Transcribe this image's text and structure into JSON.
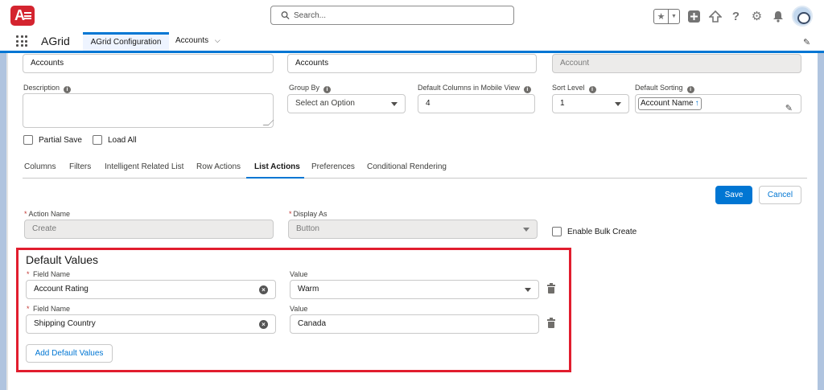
{
  "header": {
    "logo_text": "A",
    "search_placeholder": "Search..."
  },
  "nav": {
    "app_name": "AGrid",
    "tabs": [
      {
        "label": "AGrid Configuration"
      },
      {
        "label": "Accounts"
      }
    ]
  },
  "form": {
    "row1": [
      "Accounts",
      "Accounts",
      "Account"
    ],
    "description_label": "Description",
    "description_value": "",
    "group_by_label": "Group By",
    "group_by_value": "Select an Option",
    "mobile_cols_label": "Default Columns in Mobile View",
    "mobile_cols_value": "4",
    "sort_level_label": "Sort Level",
    "sort_level_value": "1",
    "default_sorting_label": "Default Sorting",
    "default_sorting_value": "Account Name",
    "partial_save_label": "Partial Save",
    "load_all_label": "Load All"
  },
  "tabs": [
    {
      "label": "Columns"
    },
    {
      "label": "Filters"
    },
    {
      "label": "Intelligent Related List"
    },
    {
      "label": "Row Actions"
    },
    {
      "label": "List Actions"
    },
    {
      "label": "Preferences"
    },
    {
      "label": "Conditional Rendering"
    }
  ],
  "actions": {
    "save_label": "Save",
    "cancel_label": "Cancel"
  },
  "list_action": {
    "action_name_label": "Action Name",
    "action_name_value": "Create",
    "display_as_label": "Display As",
    "display_as_value": "Button",
    "bulk_create_label": "Enable Bulk Create"
  },
  "default_values": {
    "title": "Default Values",
    "field_name_label": "Field Name",
    "value_label": "Value",
    "rows": [
      {
        "field": "Account Rating",
        "value": "Warm"
      },
      {
        "field": "Shipping Country",
        "value": "Canada"
      }
    ],
    "add_label": "Add Default Values"
  },
  "colors": {
    "brand": "#0176d3",
    "highlight": "#e11d2e",
    "logo": "#d4242f"
  }
}
